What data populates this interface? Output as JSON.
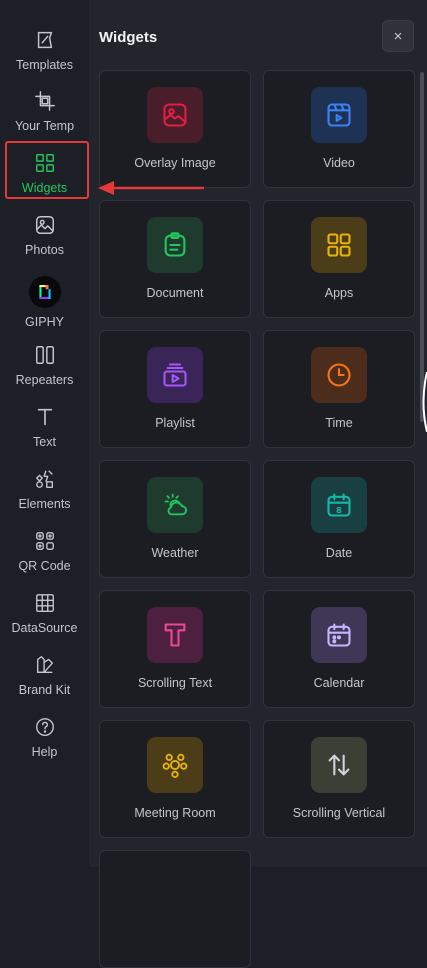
{
  "sidebar": {
    "items": [
      {
        "label": "Templates",
        "icon": "templates-icon"
      },
      {
        "label": "Your Temp",
        "icon": "crop-icon"
      },
      {
        "label": "Widgets",
        "icon": "widgets-grid-icon",
        "active": true
      },
      {
        "label": "Photos",
        "icon": "photo-icon"
      },
      {
        "label": "GIPHY",
        "icon": "giphy-icon"
      },
      {
        "label": "Repeaters",
        "icon": "repeaters-icon"
      },
      {
        "label": "Text",
        "icon": "text-icon"
      },
      {
        "label": "Elements",
        "icon": "elements-icon"
      },
      {
        "label": "QR Code",
        "icon": "qr-code-icon"
      },
      {
        "label": "DataSource",
        "icon": "table-icon"
      },
      {
        "label": "Brand Kit",
        "icon": "brand-kit-icon"
      },
      {
        "label": "Help",
        "icon": "help-icon"
      }
    ]
  },
  "panel": {
    "title": "Widgets",
    "close_label": "×",
    "widgets": [
      {
        "label": "Overlay Image",
        "icon": "image-icon",
        "color": "#e11d48",
        "bg": "#4a1d2b"
      },
      {
        "label": "Video",
        "icon": "video-icon",
        "color": "#3b82f6",
        "bg": "#1e3354"
      },
      {
        "label": "Document",
        "icon": "document-icon",
        "color": "#22c55e",
        "bg": "#1e3b2e"
      },
      {
        "label": "Apps",
        "icon": "apps-icon",
        "color": "#eab308",
        "bg": "#4a3d18"
      },
      {
        "label": "Playlist",
        "icon": "playlist-icon",
        "color": "#a855f7",
        "bg": "#3a2559"
      },
      {
        "label": "Time",
        "icon": "clock-icon",
        "color": "#f97316",
        "bg": "#4c2d1c"
      },
      {
        "label": "Weather",
        "icon": "weather-icon",
        "color": "#22c55e",
        "bg": "#1e3b2e"
      },
      {
        "label": "Date",
        "icon": "calendar-date-icon",
        "color": "#14b8a6",
        "bg": "#1a3f43"
      },
      {
        "label": "Scrolling Text",
        "icon": "scrolling-text-icon",
        "color": "#ec4899",
        "bg": "#4d2040"
      },
      {
        "label": "Calendar",
        "icon": "calendar-icon",
        "color": "#c4b5fd",
        "bg": "#3e3856"
      },
      {
        "label": "Meeting Room",
        "icon": "meeting-room-icon",
        "color": "#eab308",
        "bg": "#4a3d18"
      },
      {
        "label": "Scrolling Vertical",
        "icon": "scroll-vertical-icon",
        "color": "#d1d5db",
        "bg": "#3b4037"
      }
    ]
  },
  "colors": {
    "accent": "#22c55e",
    "annotation": "#e5383b"
  }
}
